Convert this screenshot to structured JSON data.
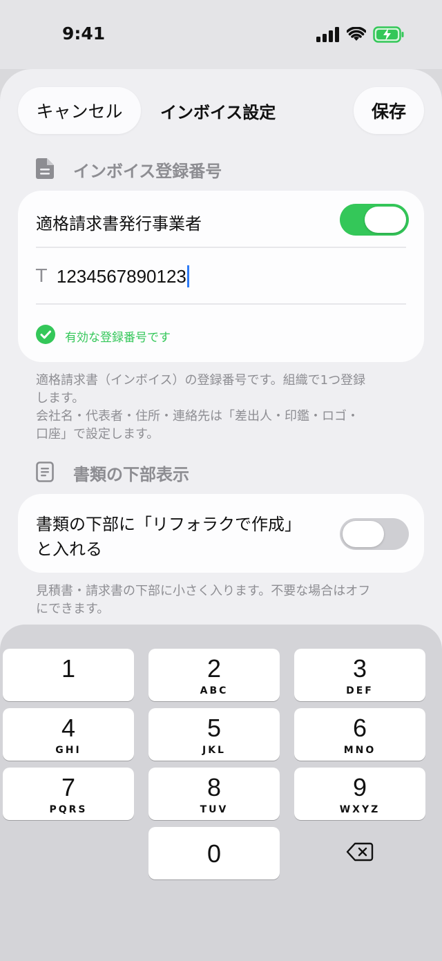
{
  "status_bar": {
    "time": "9:41"
  },
  "header": {
    "cancel_label": "キャンセル",
    "title": "インボイス設定",
    "save_label": "保存"
  },
  "invoice_section": {
    "title": "インボイス登録番号",
    "toggle_label": "適格請求書発行事業者",
    "toggle_on": true,
    "number_prefix": "T",
    "number_value": "1234567890123",
    "validation_text": "有効な登録番号です",
    "note_lines": [
      "適格請求書（インボイス）の登録番号です。組織で1つ登録",
      "します。",
      "会社名・代表者・住所・連絡先は「差出人・印鑑・ロゴ・",
      "口座」で設定します。"
    ]
  },
  "footer_section": {
    "title": "書類の下部表示",
    "toggle_label_line1": "書類の下部に「リフォラクで作成」",
    "toggle_label_line2": "と入れる",
    "toggle_on": false,
    "note_lines": [
      "見積書・請求書の下部に小さく入ります。不要な場合はオフ",
      "にできます。"
    ]
  },
  "keypad": {
    "keys": [
      {
        "digit": "1",
        "letters": ""
      },
      {
        "digit": "2",
        "letters": "ABC"
      },
      {
        "digit": "3",
        "letters": "DEF"
      },
      {
        "digit": "4",
        "letters": "GHI"
      },
      {
        "digit": "5",
        "letters": "JKL"
      },
      {
        "digit": "6",
        "letters": "MNO"
      },
      {
        "digit": "7",
        "letters": "PQRS"
      },
      {
        "digit": "8",
        "letters": "TUV"
      },
      {
        "digit": "9",
        "letters": "WXYZ"
      },
      {
        "digit": "0",
        "letters": ""
      }
    ]
  },
  "colors": {
    "accent_green": "#34c759",
    "cursor_blue": "#2f7cf6",
    "muted_text": "#8e8e93"
  }
}
